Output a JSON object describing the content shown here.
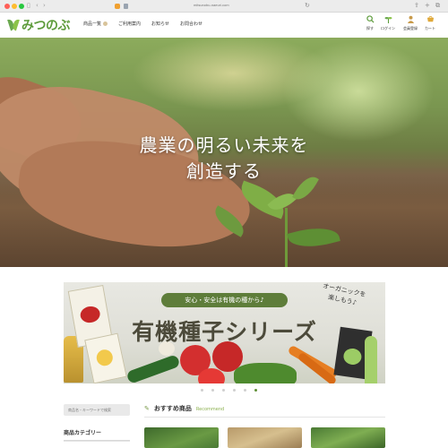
{
  "browser": {
    "url": "mitsunobu-naeuri.com",
    "icons": {
      "back": "chevron-left-icon",
      "forward": "chevron-right-icon",
      "reload": "reload-icon",
      "share": "share-icon",
      "new_tab": "plus-icon",
      "tabs": "tabs-icon"
    }
  },
  "header": {
    "logo_text": "みつのぶ",
    "nav": [
      {
        "label": "商品一覧"
      },
      {
        "label": "ご利用案内"
      },
      {
        "label": "お知らせ"
      },
      {
        "label": "お問合わせ"
      }
    ],
    "utility": [
      {
        "label": "探す",
        "icon": "search-icon"
      },
      {
        "label": "ログイン",
        "icon": "sprout-icon"
      },
      {
        "label": "会員登録",
        "icon": "user-icon"
      },
      {
        "label": "カート",
        "icon": "cart-icon"
      }
    ]
  },
  "hero": {
    "title_line1": "農業の明るい未来を",
    "title_line2": "創造する"
  },
  "banner": {
    "pill": "安心・安全は有機の種から♪",
    "title": "有機種子シリーズ",
    "note_line1": "オーガニックを",
    "note_line2": "楽しもう♪"
  },
  "slider": {
    "count": 6,
    "active_index": 5
  },
  "sidebar": {
    "search_placeholder": "商品名・キーワードで検索",
    "category_heading": "商品カテゴリー"
  },
  "recommend": {
    "title": "おすすめ商品",
    "subtitle": "Recommend"
  },
  "colors": {
    "brand_green": "#5d9b3b",
    "accent_green": "#5e7d3a",
    "hero_text": "#ffffff"
  }
}
